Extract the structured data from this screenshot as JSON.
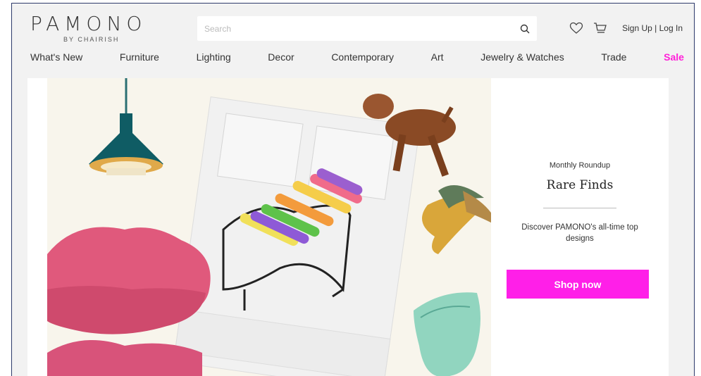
{
  "header": {
    "logo": "PAMONO",
    "logo_sub": "BY CHAIRISH",
    "search": {
      "placeholder": "Search",
      "value": ""
    },
    "auth": {
      "sign_up": "Sign Up",
      "separator": " | ",
      "log_in": "Log In"
    },
    "icons": [
      "search-icon",
      "heart-icon",
      "cart-icon"
    ]
  },
  "nav": {
    "items": [
      {
        "label": "What's New"
      },
      {
        "label": "Furniture"
      },
      {
        "label": "Lighting"
      },
      {
        "label": "Decor"
      },
      {
        "label": "Contemporary"
      },
      {
        "label": "Art"
      },
      {
        "label": "Jewelry & Watches"
      },
      {
        "label": "Trade"
      },
      {
        "label": "Sale"
      }
    ],
    "sale_color": "#ff1fd8"
  },
  "hero": {
    "eyebrow": "Monthly Roundup",
    "title": "Rare Finds",
    "description": "Discover PAMONO's all-time top designs",
    "cta": "Shop now",
    "cta_color": "#ff1fe8"
  }
}
